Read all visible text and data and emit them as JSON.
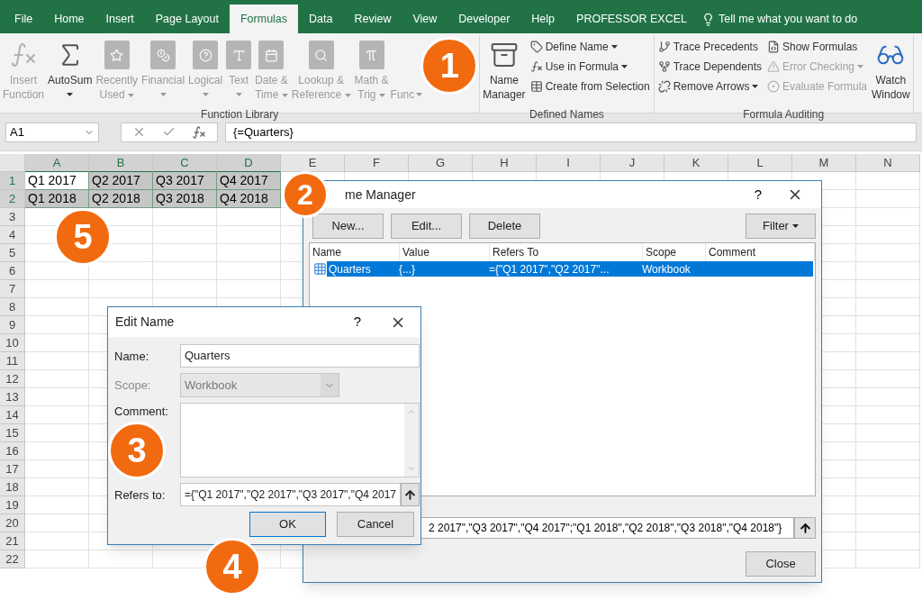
{
  "tabs": [
    {
      "label": "File",
      "selected": false
    },
    {
      "label": "Home",
      "selected": false
    },
    {
      "label": "Insert",
      "selected": false
    },
    {
      "label": "Page Layout",
      "selected": false
    },
    {
      "label": "Formulas",
      "selected": true
    },
    {
      "label": "Data",
      "selected": false
    },
    {
      "label": "Review",
      "selected": false
    },
    {
      "label": "View",
      "selected": false
    },
    {
      "label": "Developer",
      "selected": false
    },
    {
      "label": "Help",
      "selected": false
    },
    {
      "label": "PROFESSOR EXCEL",
      "selected": false
    }
  ],
  "tell_me": "Tell me what you want to do",
  "ribbon": {
    "groups": [
      {
        "label": "Function Library",
        "items": [
          {
            "kind": "large",
            "lines": [
              "Insert",
              "Function"
            ],
            "disabled": true,
            "dropdown": false
          },
          {
            "kind": "large",
            "lines": [
              "AutoSum"
            ],
            "disabled": false,
            "dropdown": true
          },
          {
            "kind": "large",
            "lines": [
              "Recently",
              "Used"
            ],
            "disabled": true,
            "dropdown": true
          },
          {
            "kind": "large",
            "lines": [
              "Financial"
            ],
            "disabled": true,
            "dropdown": true
          },
          {
            "kind": "large",
            "lines": [
              "Logical"
            ],
            "disabled": true,
            "dropdown": true
          },
          {
            "kind": "large",
            "lines": [
              "Text"
            ],
            "disabled": true,
            "dropdown": true
          },
          {
            "kind": "large",
            "lines": [
              "Date &",
              "Time"
            ],
            "disabled": true,
            "dropdown": true
          },
          {
            "kind": "large",
            "lines": [
              "Lookup &",
              "Reference"
            ],
            "disabled": true,
            "dropdown": true
          },
          {
            "kind": "large",
            "lines": [
              "Math &",
              "Trig"
            ],
            "disabled": true,
            "dropdown": true
          },
          {
            "kind": "covered",
            "lines": [
              "Func"
            ],
            "disabled": true,
            "dropdown": true
          }
        ]
      },
      {
        "label": "Defined Names",
        "items": [
          {
            "kind": "large",
            "lines": [
              "Name",
              "Manager"
            ],
            "disabled": false,
            "dropdown": false
          },
          {
            "kind": "small",
            "lines": [
              "Define Name"
            ],
            "disabled": false,
            "dropdown": true
          },
          {
            "kind": "small",
            "lines": [
              "Use in Formula"
            ],
            "disabled": false,
            "dropdown": true
          },
          {
            "kind": "small",
            "lines": [
              "Create from Selection"
            ],
            "disabled": false,
            "dropdown": false
          }
        ]
      },
      {
        "label": "Formula Auditing",
        "items": [
          {
            "kind": "small",
            "lines": [
              "Trace Precedents"
            ],
            "disabled": false,
            "dropdown": false
          },
          {
            "kind": "small",
            "lines": [
              "Trace Dependents"
            ],
            "disabled": false,
            "dropdown": false
          },
          {
            "kind": "small",
            "lines": [
              "Remove Arrows"
            ],
            "disabled": false,
            "dropdown": true
          },
          {
            "kind": "small",
            "lines": [
              "Show Formulas"
            ],
            "disabled": false,
            "dropdown": false
          },
          {
            "kind": "small",
            "lines": [
              "Error Checking"
            ],
            "disabled": true,
            "dropdown": true
          },
          {
            "kind": "small",
            "lines": [
              "Evaluate Formula"
            ],
            "disabled": true,
            "dropdown": false
          },
          {
            "kind": "large",
            "lines": [
              "Watch",
              "Window"
            ],
            "disabled": false,
            "dropdown": false
          }
        ]
      }
    ]
  },
  "formula_bar": {
    "name_box": "A1",
    "formula": "{=Quarters}"
  },
  "grid": {
    "columns": [
      {
        "label": "A",
        "selected": true
      },
      {
        "label": "B",
        "selected": true
      },
      {
        "label": "C",
        "selected": true
      },
      {
        "label": "D",
        "selected": true
      },
      {
        "label": "E",
        "selected": false
      },
      {
        "label": "F",
        "selected": false
      },
      {
        "label": "G",
        "selected": false
      },
      {
        "label": "H",
        "selected": false
      },
      {
        "label": "I",
        "selected": false
      },
      {
        "label": "J",
        "selected": false
      },
      {
        "label": "K",
        "selected": false
      },
      {
        "label": "L",
        "selected": false
      },
      {
        "label": "M",
        "selected": false
      },
      {
        "label": "N",
        "selected": false
      }
    ],
    "rows": [
      {
        "label": "1",
        "selected": true,
        "cells": [
          {
            "text": "Q1 2017",
            "selected": true,
            "active": true
          },
          {
            "text": "Q2 2017",
            "selected": true,
            "active": false
          },
          {
            "text": "Q3 2017",
            "selected": true,
            "active": false
          },
          {
            "text": "Q4 2017",
            "selected": true,
            "active": false
          }
        ]
      },
      {
        "label": "2",
        "selected": true,
        "cells": [
          {
            "text": "Q1 2018",
            "selected": true,
            "active": false
          },
          {
            "text": "Q2 2018",
            "selected": true,
            "active": false
          },
          {
            "text": "Q3 2018",
            "selected": true,
            "active": false
          },
          {
            "text": "Q4 2018",
            "selected": true,
            "active": false
          }
        ]
      },
      {
        "label": "3",
        "selected": false
      },
      {
        "label": "4",
        "selected": false
      },
      {
        "label": "5",
        "selected": false
      },
      {
        "label": "6",
        "selected": false
      },
      {
        "label": "7",
        "selected": false
      },
      {
        "label": "8",
        "selected": false
      },
      {
        "label": "9",
        "selected": false
      },
      {
        "label": "10",
        "selected": false
      },
      {
        "label": "11",
        "selected": false
      },
      {
        "label": "12",
        "selected": false
      },
      {
        "label": "13",
        "selected": false
      },
      {
        "label": "14",
        "selected": false
      },
      {
        "label": "15",
        "selected": false
      },
      {
        "label": "16",
        "selected": false
      },
      {
        "label": "17",
        "selected": false
      },
      {
        "label": "18",
        "selected": false
      },
      {
        "label": "19",
        "selected": false
      },
      {
        "label": "20",
        "selected": false
      },
      {
        "label": "21",
        "selected": false
      },
      {
        "label": "22",
        "selected": false
      }
    ]
  },
  "name_manager": {
    "title": "me Manager",
    "help": "?",
    "buttons": [
      "New...",
      "Edit...",
      "Delete"
    ],
    "filter": "Filter",
    "columns": [
      "Name",
      "Value",
      "Refers To",
      "Scope",
      "Comment"
    ],
    "rows": [
      {
        "name": "Quarters",
        "value": "{...}",
        "refers_to": "={\"Q1 2017\",\"Q2 2017\"...",
        "scope": "Workbook",
        "selected": true
      }
    ],
    "refers_to_field": "2 2017\",\"Q3 2017\",\"Q4 2017\";\"Q1 2018\",\"Q2 2018\",\"Q3 2018\",\"Q4 2018\"}",
    "close": "Close"
  },
  "edit_name": {
    "title": "Edit Name",
    "help": "?",
    "name_label": "Name:",
    "name": "Quarters",
    "scope_label": "Scope:",
    "scope": "Workbook",
    "scope_disabled": true,
    "comment_label": "Comment:",
    "refers_label": "Refers to:",
    "refers_to": "={\"Q1 2017\",\"Q2 2017\",\"Q3 2017\",\"Q4 2017",
    "ok": "OK",
    "cancel": "Cancel"
  },
  "badges": [
    "1",
    "2",
    "3",
    "4",
    "5"
  ]
}
